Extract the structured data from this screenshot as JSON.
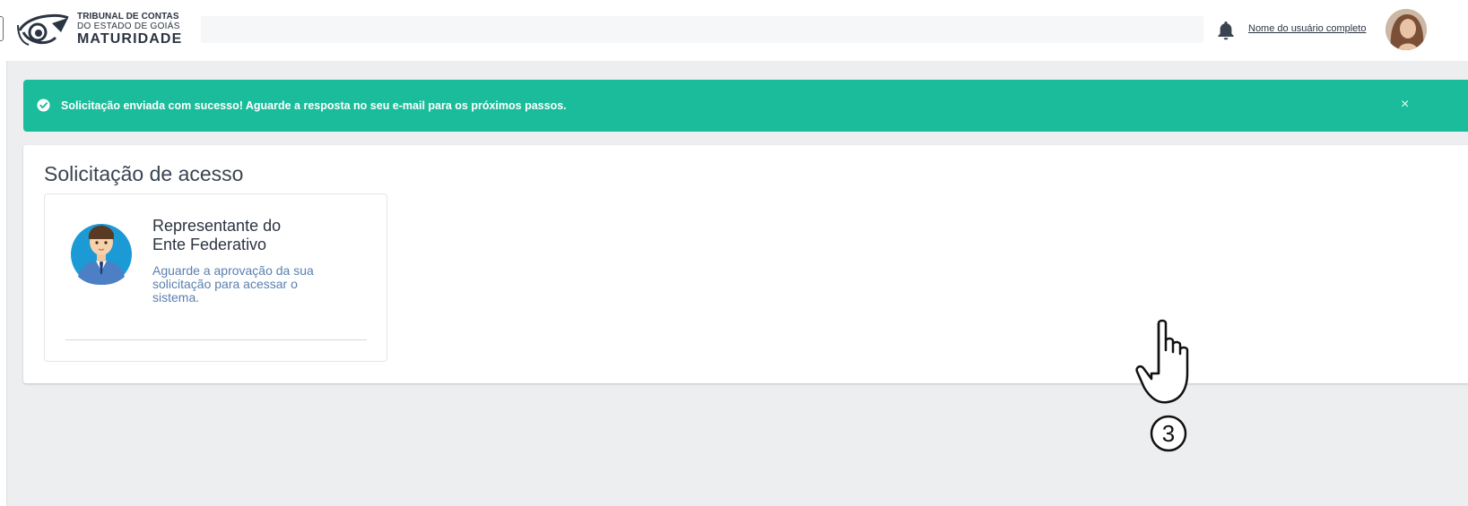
{
  "header": {
    "logo": {
      "line1": "TRIBUNAL DE CONTAS",
      "line2": "DO ESTADO DE GOIÁS",
      "line3": "MATURIDADE"
    },
    "bell_icon": "bell-icon",
    "user_name": "Nome do usuário completo",
    "avatar_icon": "user-photo-avatar"
  },
  "alert": {
    "icon": "check-circle-icon",
    "message": "Solicitação enviada com sucesso! Aguarde  a resposta no seu e-mail para os próximos passos.",
    "close_label": "×",
    "color": "#1bbc9b"
  },
  "card": {
    "title": "Solicitação de acesso",
    "option": {
      "icon": "businessman-avatar-icon",
      "title_line1": "Representante do",
      "title_line2": "Ente Federativo",
      "desc_line1": "Aguarde a aprovação da sua",
      "desc_line2": "solicitação para acessar o",
      "desc_line3": "sistema."
    }
  },
  "annotation": {
    "cursor_icon": "hand-pointer-icon",
    "step_number": "3"
  },
  "colors": {
    "accent": "#1bbc9b",
    "background": "#eceeef",
    "text": "#2b3442",
    "link_desc": "#5a7fb0"
  }
}
